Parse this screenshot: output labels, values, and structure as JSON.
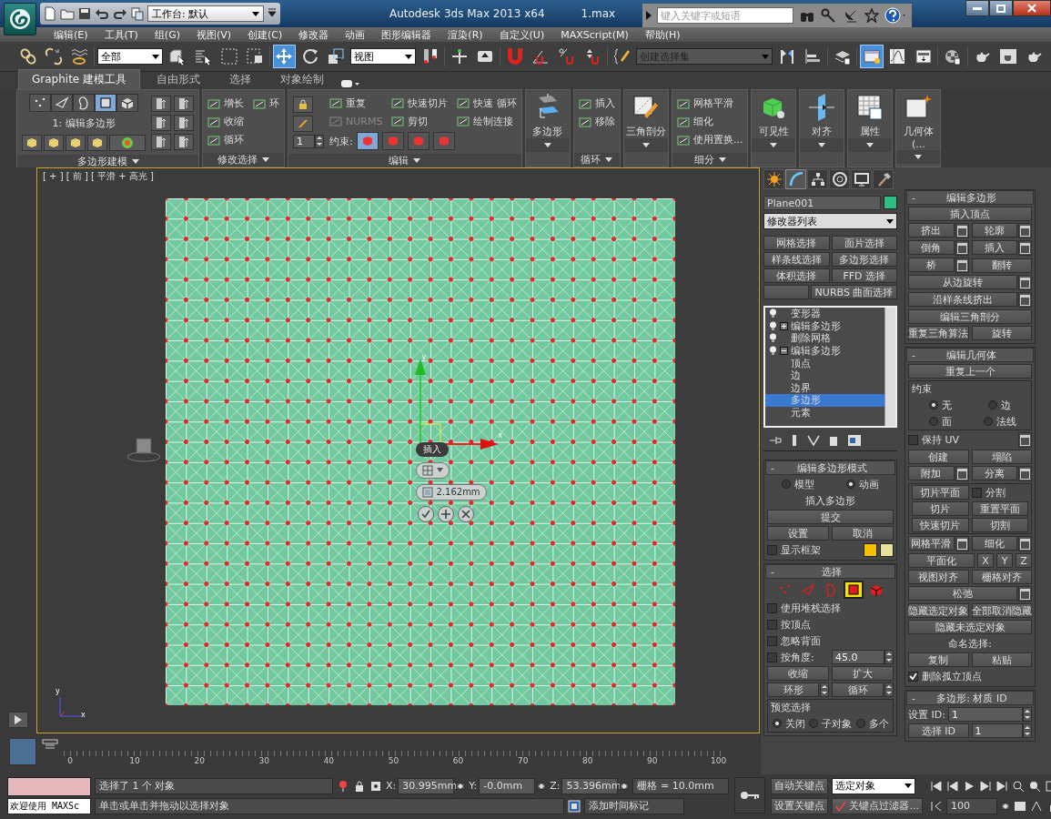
{
  "title_bar": {
    "workspace": "工作台: 默认",
    "app_title": "Autodesk 3ds Max  2013 x64",
    "file": "1.max",
    "search": {
      "placeholder": "键入关键字或短语"
    }
  },
  "menu": [
    "编辑(E)",
    "工具(T)",
    "组(G)",
    "视图(V)",
    "创建(C)",
    "修改器",
    "动画",
    "图形编辑器",
    "渲染(R)",
    "自定义(U)",
    "MAXScript(M)",
    "帮助(H)"
  ],
  "main_toolbar": {
    "tools": [
      {
        "kind": "link",
        "selected": false
      },
      {
        "kind": "unlink",
        "selected": false
      },
      {
        "kind": "bind",
        "selected": false
      },
      {
        "kind": "sep"
      },
      {
        "kind": "dropdown",
        "value": "全部"
      },
      {
        "kind": "select",
        "selected": false
      },
      {
        "kind": "byname",
        "selected": false
      },
      {
        "kind": "region",
        "selected": false
      },
      {
        "kind": "crossing",
        "selected": false
      },
      {
        "kind": "sep"
      },
      {
        "kind": "move",
        "selected": true
      },
      {
        "kind": "rotate",
        "selected": false
      },
      {
        "kind": "scale",
        "selected": false
      },
      {
        "kind": "dropdown",
        "value": "视图"
      },
      {
        "kind": "pivot",
        "selected": false
      },
      {
        "kind": "sep"
      },
      {
        "kind": "manipulate",
        "selected": false
      },
      {
        "kind": "keyboard",
        "selected": false
      },
      {
        "kind": "sep"
      },
      {
        "kind": "snap",
        "selected": false
      },
      {
        "kind": "angle",
        "selected": false
      },
      {
        "kind": "percent",
        "selected": false
      },
      {
        "kind": "spinsnap",
        "selected": false
      },
      {
        "kind": "sep"
      },
      {
        "kind": "editsets",
        "selected": false
      },
      {
        "kind": "dropdown",
        "value": "创建选择集"
      },
      {
        "kind": "mirror",
        "selected": false
      },
      {
        "kind": "align",
        "selected": false
      },
      {
        "kind": "sep"
      },
      {
        "kind": "layers",
        "selected": false
      },
      {
        "kind": "sep"
      },
      {
        "kind": "explorer",
        "selected": true
      },
      {
        "kind": "curve",
        "selected": false
      },
      {
        "kind": "schematic",
        "selected": false
      },
      {
        "kind": "sep"
      },
      {
        "kind": "material",
        "selected": false
      },
      {
        "kind": "sep"
      },
      {
        "kind": "teapot",
        "selected": false
      },
      {
        "kind": "frame",
        "selected": false
      },
      {
        "kind": "teapot",
        "selected": false
      }
    ]
  },
  "ribbon_tabs": [
    {
      "label": "Graphite 建模工具",
      "selected": true
    },
    {
      "label": "自由形式",
      "selected": false
    },
    {
      "label": "选择",
      "selected": false
    },
    {
      "label": "对象绘制",
      "selected": false
    }
  ],
  "ribbon_panels": [
    {
      "kind": "modeling",
      "title": "多边形建模",
      "caption": "1: 编辑多边形",
      "subobjects": [
        {
          "kind": "vertex",
          "selected": false
        },
        {
          "kind": "edge",
          "selected": false
        },
        {
          "kind": "border",
          "selected": false
        },
        {
          "kind": "polygon",
          "selected": true
        },
        {
          "kind": "element",
          "selected": false
        }
      ]
    },
    {
      "kind": "tools",
      "title": "修改选择",
      "tools": [
        {
          "label": "增长",
          "disabled": false
        },
        {
          "label": "收缩",
          "disabled": false
        },
        {
          "label": "循环",
          "disabled": false
        },
        {
          "label": "环",
          "disabled": false
        }
      ]
    },
    {
      "kind": "tools",
      "title": "编辑",
      "spinner": "1",
      "tools": [
        {
          "label": "重复",
          "disabled": false
        },
        {
          "label": "NURMS",
          "disabled": true
        },
        {
          "label": "快速切片",
          "disabled": false
        },
        {
          "label": "剪切",
          "disabled": false
        },
        {
          "label": "快速 循环",
          "disabled": false
        },
        {
          "label": "绘制连接",
          "disabled": false
        }
      ],
      "constraint": {
        "label": "约束:",
        "options": [
          {
            "selected": true
          },
          {
            "selected": false
          },
          {
            "selected": false
          },
          {
            "selected": false
          }
        ]
      }
    },
    {
      "kind": "big",
      "label": "多边形"
    },
    {
      "kind": "tools",
      "title": "循环",
      "tools": [
        {
          "label": "插入",
          "disabled": false
        },
        {
          "label": "移除",
          "disabled": false
        }
      ]
    },
    {
      "kind": "big",
      "label": "三角剖分"
    },
    {
      "kind": "tools",
      "title": "细分",
      "tools": [
        {
          "label": "网格平滑",
          "disabled": false
        },
        {
          "label": "细化",
          "disabled": false
        },
        {
          "label": "使用置换...",
          "disabled": false
        }
      ]
    },
    {
      "kind": "big",
      "label": "可见性"
    },
    {
      "kind": "big",
      "label": "对齐"
    },
    {
      "kind": "big",
      "label": "属性"
    },
    {
      "kind": "big",
      "label": "几何体 (..."
    }
  ],
  "viewport": {
    "label": "[ + ] [ 前 ] [ 平滑 + 高光 ]",
    "gizmo": {
      "y_label": "y",
      "x_label": "x"
    },
    "caddy": {
      "title": "插入",
      "value": "2.162mm"
    },
    "tripod": {
      "y_label": "y",
      "x_label": "x"
    }
  },
  "timeline": {
    "ticks": [
      "0",
      "10",
      "20",
      "30",
      "40",
      "50",
      "60",
      "70",
      "80",
      "90",
      "100"
    ]
  },
  "command_panel": {
    "tabs": [
      {
        "kind": "create",
        "selected": false
      },
      {
        "kind": "modify",
        "selected": true
      },
      {
        "kind": "hierarchy",
        "selected": false
      },
      {
        "kind": "motion",
        "selected": false
      },
      {
        "kind": "display",
        "selected": false
      },
      {
        "kind": "utilities",
        "selected": false
      }
    ],
    "object_name": "Plane001",
    "modifier_list": "修改器列表",
    "modifier_buttons": [
      [
        "网格选择",
        "面片选择"
      ],
      [
        "样条线选择",
        "多边形选择"
      ],
      [
        "体积选择",
        "FFD 选择"
      ],
      [
        "NURBS 曲面选择"
      ]
    ],
    "stack": [
      {
        "label": "变形器",
        "selected": false
      },
      {
        "label": "编辑多边形",
        "selected": false,
        "expanded": false
      },
      {
        "label": "删除网格",
        "selected": false
      },
      {
        "label": "编辑多边形",
        "selected": false,
        "expanded": true,
        "children": [
          {
            "label": "顶点",
            "selected": false
          },
          {
            "label": "边",
            "selected": false
          },
          {
            "label": "边界",
            "selected": false
          },
          {
            "label": "多边形",
            "selected": true
          },
          {
            "label": "元素",
            "selected": false
          }
        ]
      }
    ],
    "left_rollouts": [
      {
        "toggle": "-",
        "title": "编辑多边形模式",
        "rows": [
          [
            {
              "kind": "radio",
              "label": "模型",
              "selected": false
            },
            {
              "kind": "radio",
              "label": "动画",
              "selected": true
            }
          ],
          [
            {
              "kind": "label",
              "label": "插入多边形"
            }
          ],
          [
            {
              "kind": "button",
              "label": "提交"
            }
          ],
          [
            {
              "kind": "button",
              "label": "设置"
            },
            {
              "kind": "button",
              "label": "取消"
            }
          ],
          [
            {
              "kind": "checkbox",
              "label": "显示框架",
              "checked": false
            },
            {
              "kind": "swatch",
              "color": "#f5c000"
            },
            {
              "kind": "swatch",
              "color": "#e6e29c"
            }
          ]
        ]
      },
      {
        "toggle": "-",
        "title": "选择",
        "rows": [
          [
            {
              "kind": "levels",
              "options": [
                {
                  "kind": "vertex",
                  "selected": false
                },
                {
                  "kind": "edge",
                  "selected": false
                },
                {
                  "kind": "border",
                  "selected": false
                },
                {
                  "kind": "polygon",
                  "selected": true
                },
                {
                  "kind": "element",
                  "selected": false
                }
              ]
            }
          ],
          [
            {
              "kind": "checkbox",
              "label": "使用堆栈选择",
              "checked": false
            }
          ],
          [
            {
              "kind": "checkbox",
              "label": "按顶点",
              "checked": false
            }
          ],
          [
            {
              "kind": "checkbox",
              "label": "忽略背面",
              "checked": false
            }
          ],
          [
            {
              "kind": "checkbox",
              "label": "按角度:",
              "checked": false
            },
            {
              "kind": "spinner",
              "value": "45.0"
            }
          ],
          [
            {
              "kind": "button",
              "label": "收缩"
            },
            {
              "kind": "button",
              "label": "扩大"
            }
          ],
          [
            {
              "kind": "step_button",
              "label": "环形"
            },
            {
              "kind": "step_button",
              "label": "循环"
            }
          ],
          [
            {
              "kind": "group",
              "title": "预览选择",
              "rows": [
                [
                  {
                    "kind": "radio",
                    "label": "关闭",
                    "selected": true
                  },
                  {
                    "kind": "radio",
                    "label": "子对象",
                    "selected": false
                  },
                  {
                    "kind": "radio",
                    "label": "多个",
                    "selected": false
                  }
                ]
              ]
            }
          ]
        ]
      }
    ],
    "right_rollouts": [
      {
        "toggle": "-",
        "title": "编辑多边形",
        "rows": [
          [
            {
              "kind": "button",
              "label": "插入顶点"
            }
          ],
          [
            {
              "kind": "button",
              "label": "挤出",
              "settings": true
            },
            {
              "kind": "button",
              "label": "轮廓",
              "settings": true
            }
          ],
          [
            {
              "kind": "button",
              "label": "倒角",
              "settings": true
            },
            {
              "kind": "button",
              "label": "插入",
              "settings": true
            }
          ],
          [
            {
              "kind": "button",
              "label": "桥",
              "settings": true
            },
            {
              "kind": "button",
              "label": "翻转"
            }
          ],
          [
            {
              "kind": "button",
              "label": "从边旋转",
              "settings": true
            }
          ],
          [
            {
              "kind": "button",
              "label": "沿样条线挤出",
              "settings": true
            }
          ],
          [
            {
              "kind": "button",
              "label": "编辑三角剖分"
            }
          ],
          [
            {
              "kind": "button",
              "label": "重复三角算法"
            },
            {
              "kind": "button",
              "label": "旋转"
            }
          ]
        ]
      },
      {
        "toggle": "-",
        "title": "编辑几何体",
        "rows": [
          [
            {
              "kind": "button",
              "label": "重复上一个"
            }
          ],
          [
            {
              "kind": "group",
              "title": "约束",
              "rows": [
                [
                  {
                    "kind": "radio",
                    "label": "无",
                    "selected": true
                  },
                  {
                    "kind": "radio",
                    "label": "边",
                    "selected": false
                  }
                ],
                [
                  {
                    "kind": "radio",
                    "label": "面",
                    "selected": false
                  },
                  {
                    "kind": "radio",
                    "label": "法线",
                    "selected": false
                  }
                ]
              ]
            }
          ],
          [
            {
              "kind": "checkbox",
              "label": "保持 UV",
              "checked": false
            },
            {
              "kind": "settings"
            }
          ],
          [
            {
              "kind": "button",
              "label": "创建"
            },
            {
              "kind": "button",
              "label": "塌陷"
            }
          ],
          [
            {
              "kind": "button",
              "label": "附加",
              "settings": true
            },
            {
              "kind": "button",
              "label": "分离",
              "settings": true
            }
          ],
          [
            {
              "kind": "group",
              "rows": [
                [
                  {
                    "kind": "button",
                    "label": "切片平面"
                  },
                  {
                    "kind": "checkbox",
                    "label": "分割",
                    "checked": false
                  }
                ],
                [
                  {
                    "kind": "button",
                    "label": "切片"
                  },
                  {
                    "kind": "button",
                    "label": "重置平面"
                  }
                ],
                [
                  {
                    "kind": "button",
                    "label": "快速切片"
                  },
                  {
                    "kind": "button",
                    "label": "切割"
                  }
                ]
              ]
            }
          ],
          [
            {
              "kind": "button",
              "label": "网格平滑",
              "settings": true
            },
            {
              "kind": "button",
              "label": "细化",
              "settings": true
            }
          ],
          [
            {
              "kind": "button",
              "label": "平面化"
            },
            {
              "kind": "small",
              "label": "X"
            },
            {
              "kind": "small",
              "label": "Y"
            },
            {
              "kind": "small",
              "label": "Z"
            }
          ],
          [
            {
              "kind": "button",
              "label": "视图对齐"
            },
            {
              "kind": "button",
              "label": "栅格对齐"
            }
          ],
          [
            {
              "kind": "button",
              "label": "松弛",
              "settings": true
            }
          ],
          [
            {
              "kind": "button",
              "label": "隐藏选定对象"
            },
            {
              "kind": "button",
              "label": "全部取消隐藏"
            }
          ],
          [
            {
              "kind": "button",
              "label": "隐藏未选定对象"
            }
          ],
          [
            {
              "kind": "label",
              "label": "命名选择:"
            }
          ],
          [
            {
              "kind": "button",
              "label": "复制"
            },
            {
              "kind": "button",
              "label": "粘贴"
            }
          ],
          [
            {
              "kind": "checkbox",
              "label": "删除孤立顶点",
              "checked": true
            }
          ]
        ]
      },
      {
        "toggle": "-",
        "title": "多边形: 材质 ID",
        "rows": [
          [
            {
              "kind": "label",
              "label": "设置 ID:"
            },
            {
              "kind": "spinner",
              "value": "1"
            }
          ],
          [
            {
              "kind": "button",
              "label": "选择 ID"
            },
            {
              "kind": "spinner",
              "value": "1"
            }
          ]
        ]
      }
    ]
  },
  "status_bar": {
    "listener": "欢迎使用 MAXSc",
    "selection_info": "选择了 1 个 对象",
    "hint": "单击或单击并拖动以选择对象",
    "coords": [
      {
        "axis": "X:",
        "value": "30.995mm"
      },
      {
        "axis": "Y:",
        "value": "-0.0mm"
      },
      {
        "axis": "Z:",
        "value": "53.396mm"
      }
    ],
    "grid": "栅格 = 10.0mm",
    "time_tag": "添加时间标记",
    "auto_key": "自动关键点",
    "set_key": "设置关键点",
    "key_mode": "选定对象",
    "key_filters": "关键点过滤器...",
    "frame": "100"
  }
}
